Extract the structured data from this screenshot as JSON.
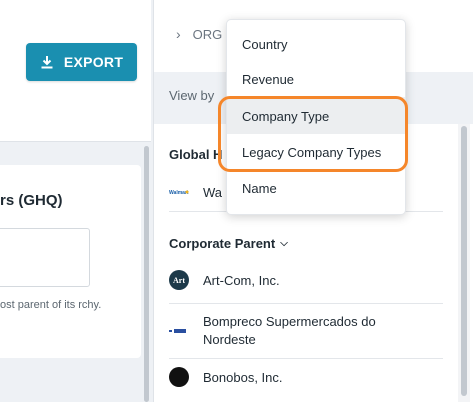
{
  "toolbar": {
    "export_label": "EXPORT"
  },
  "ghq": {
    "title": "rs (GHQ)",
    "help_text": "ost parent of its rchy."
  },
  "breadcrumb": {
    "text": "ORG"
  },
  "view_by": {
    "label": "View by"
  },
  "dropdown": {
    "options": [
      "Country",
      "Revenue",
      "Company Type",
      "Legacy Company Types",
      "Name"
    ],
    "hovered": "Company Type"
  },
  "sections": {
    "global": {
      "title": "Global H",
      "first_item": "Wa"
    },
    "corporate_parent": {
      "title": "Corporate Parent",
      "items": [
        {
          "name": "Art-Com, Inc.",
          "logo": "art-logo",
          "logo_text": "Art"
        },
        {
          "name_line1": "Bompreco Supermercados do",
          "name_line2": "Nordeste",
          "logo": "bompreco-logo"
        },
        {
          "name": "Bonobos, Inc.",
          "logo": "bonobos-logo"
        }
      ]
    }
  },
  "colors": {
    "accent": "#1a8fb0",
    "highlight": "#f5862a"
  }
}
